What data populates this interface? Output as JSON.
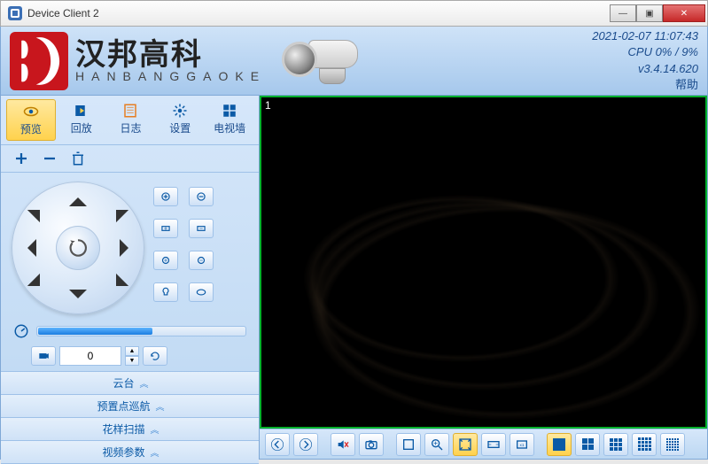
{
  "window": {
    "title": "Device Client 2"
  },
  "brand": {
    "cn": "汉邦高科",
    "en": "HANBANGGAOKE"
  },
  "status": {
    "timestamp": "2021-02-07 11:07:43",
    "cpu": "CPU  0% / 9%",
    "version": "v3.4.14.620",
    "help": "帮助"
  },
  "tabs": [
    {
      "label": "预览",
      "icon": "eye-icon",
      "active": true
    },
    {
      "label": "回放",
      "icon": "playback-icon",
      "active": false
    },
    {
      "label": "日志",
      "icon": "log-icon",
      "active": false
    },
    {
      "label": "设置",
      "icon": "settings-icon",
      "active": false
    },
    {
      "label": "电视墙",
      "icon": "tvwall-icon",
      "active": false
    }
  ],
  "preset": {
    "value": "0"
  },
  "accordion": [
    {
      "label": "云台"
    },
    {
      "label": "预置点巡航"
    },
    {
      "label": "花样扫描"
    },
    {
      "label": "视频参数"
    }
  ],
  "video": {
    "channel": "1"
  }
}
